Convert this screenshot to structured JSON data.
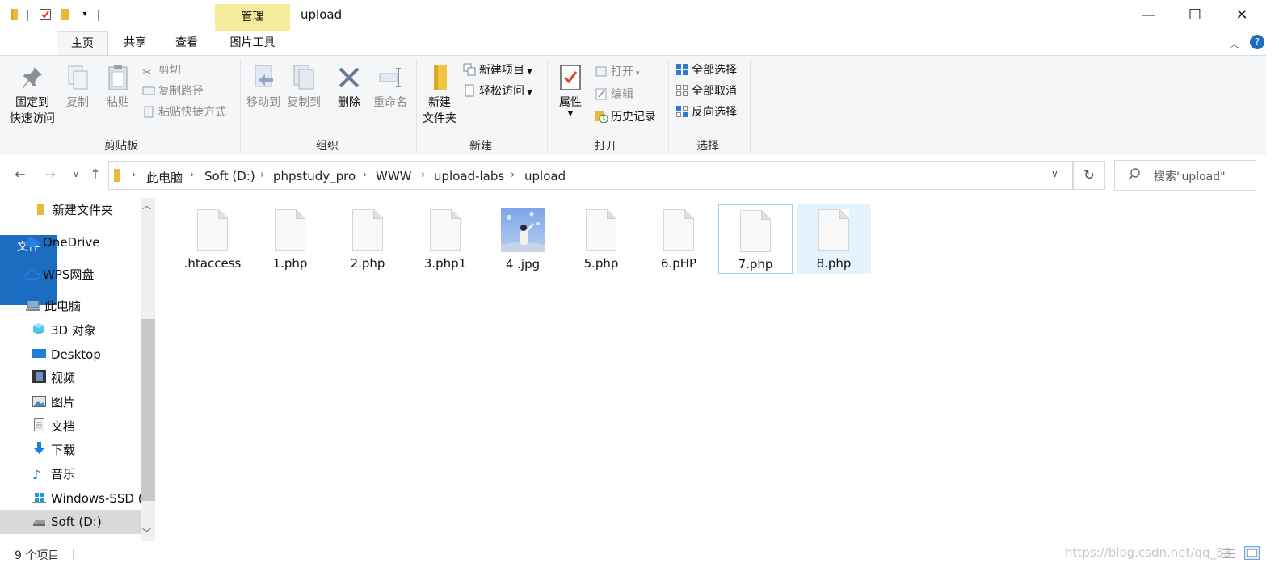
{
  "window": {
    "title": "upload",
    "contextual_tab": "管理",
    "controls": {
      "minimize": "—",
      "maximize": "☐",
      "close": "✕"
    }
  },
  "tabs": [
    {
      "label": "文件"
    },
    {
      "label": "主页"
    },
    {
      "label": "共享"
    },
    {
      "label": "查看"
    },
    {
      "label": "图片工具"
    }
  ],
  "ribbon": {
    "clipboard": {
      "label": "剪贴板",
      "pin_line1": "固定到",
      "pin_line2": "快速访问",
      "copy": "复制",
      "paste": "粘贴",
      "cut": "剪切",
      "copy_path": "复制路径",
      "paste_shortcut": "粘贴快捷方式"
    },
    "organize": {
      "label": "组织",
      "move_to": "移动到",
      "copy_to": "复制到",
      "delete": "删除",
      "rename": "重命名"
    },
    "new": {
      "label": "新建",
      "new_folder_line1": "新建",
      "new_folder_line2": "文件夹",
      "new_item": "新建项目",
      "easy_access": "轻松访问"
    },
    "open": {
      "label": "打开",
      "properties": "属性",
      "open": "打开",
      "edit": "编辑",
      "history": "历史记录"
    },
    "select": {
      "label": "选择",
      "select_all": "全部选择",
      "select_none": "全部取消",
      "invert": "反向选择"
    }
  },
  "address": {
    "crumbs": [
      "此电脑",
      "Soft (D:)",
      "phpstudy_pro",
      "WWW",
      "upload-labs",
      "upload"
    ],
    "search_placeholder": "搜索\"upload\""
  },
  "nav": {
    "items": [
      {
        "label": "新建文件夹",
        "icon": "folder-icon"
      },
      {
        "label": "OneDrive",
        "icon": "cloud-icon"
      },
      {
        "label": "WPS网盘",
        "icon": "cloud-outline-icon"
      },
      {
        "label": "此电脑",
        "icon": "computer-icon"
      },
      {
        "label": "3D 对象",
        "icon": "cube-icon"
      },
      {
        "label": "Desktop",
        "icon": "desktop-icon"
      },
      {
        "label": "视频",
        "icon": "film-icon"
      },
      {
        "label": "图片",
        "icon": "picture-icon"
      },
      {
        "label": "文档",
        "icon": "document-icon"
      },
      {
        "label": "下载",
        "icon": "download-icon"
      },
      {
        "label": "音乐",
        "icon": "music-icon"
      },
      {
        "label": "Windows-SSD (",
        "icon": "windows-drive-icon"
      },
      {
        "label": "Soft (D:)",
        "icon": "drive-icon"
      }
    ]
  },
  "files": [
    {
      "name": ".htaccess",
      "kind": "doc"
    },
    {
      "name": "1.php",
      "kind": "doc"
    },
    {
      "name": "2.php",
      "kind": "doc"
    },
    {
      "name": "3.php1",
      "kind": "doc"
    },
    {
      "name": "4 .jpg",
      "kind": "image"
    },
    {
      "name": "5.php",
      "kind": "doc"
    },
    {
      "name": "6.pHP",
      "kind": "doc"
    },
    {
      "name": "7.php",
      "kind": "doc"
    },
    {
      "name": "8.php",
      "kind": "doc"
    }
  ],
  "status": {
    "count": "9 个项目",
    "watermark": "https://blog.csdn.net/qq_53"
  },
  "colors": {
    "file_tab": "#1a6dc0",
    "contextual": "#f6eb9b",
    "selection_fill": "#e5f3ff",
    "selection_border": "#99d1ff"
  }
}
